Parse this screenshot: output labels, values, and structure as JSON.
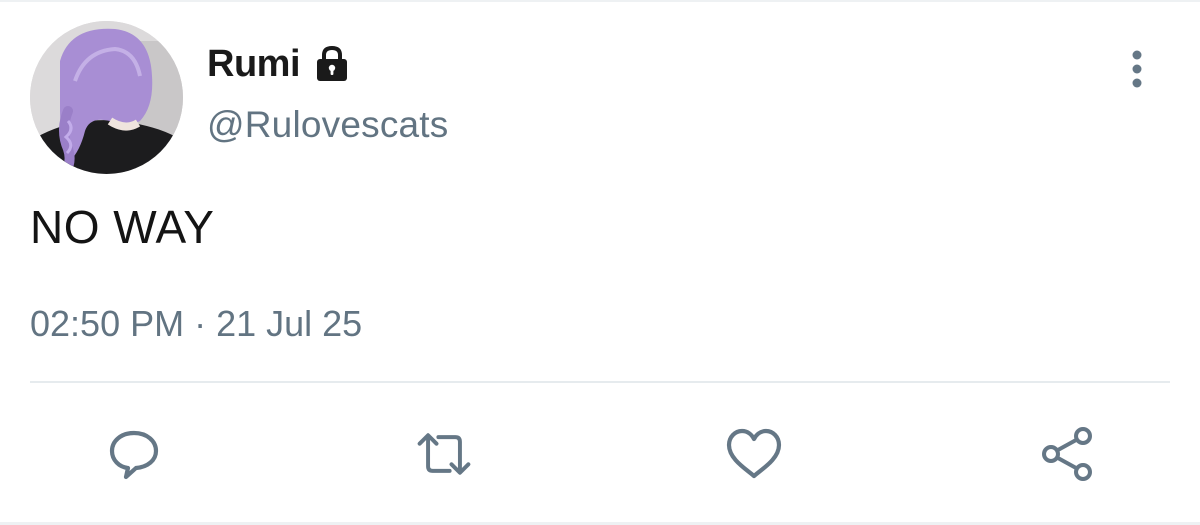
{
  "user": {
    "display_name": "Rumi",
    "handle": "@Rulovescats",
    "protected_icon": "lock-icon",
    "avatar_icon": "avatar-photo"
  },
  "tweet": {
    "text": "NO WAY",
    "time": "02:50 PM",
    "separator": "·",
    "date": "21 Jul 25"
  },
  "menu": {
    "icon": "more-vertical-icon"
  },
  "actions": [
    {
      "name": "reply",
      "icon": "reply-icon"
    },
    {
      "name": "retweet",
      "icon": "retweet-icon"
    },
    {
      "name": "like",
      "icon": "heart-icon"
    },
    {
      "name": "share",
      "icon": "share-icon"
    }
  ],
  "colors": {
    "text_primary": "#1a1a1a",
    "text_secondary": "#627482",
    "icon": "#657786",
    "divider": "#e6ebee"
  }
}
